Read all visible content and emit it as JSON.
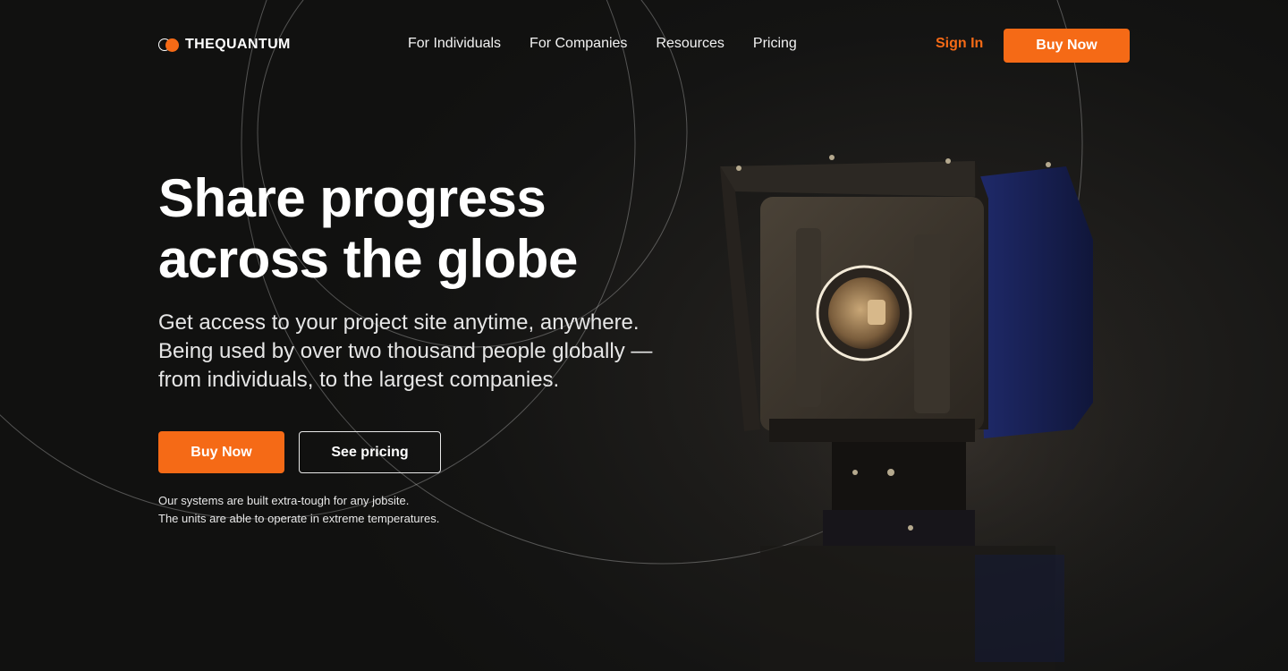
{
  "brand": {
    "name": "THEQUANTUM",
    "accent_color": "#f56a16"
  },
  "nav": {
    "links": [
      {
        "label": "For Individuals"
      },
      {
        "label": "For Companies"
      },
      {
        "label": "Resources"
      },
      {
        "label": "Pricing"
      }
    ],
    "sign_in_label": "Sign In",
    "buy_now_label": "Buy Now"
  },
  "hero": {
    "title_line1": "Share progress",
    "title_line2": "across the globe",
    "subtitle_line1": "Get access to your project site anytime, anywhere.",
    "subtitle_line2": "Being used by over two thousand people globally —",
    "subtitle_line3": "from individuals, to the largest companies.",
    "primary_cta": "Buy Now",
    "secondary_cta": "See pricing",
    "note_line1": "Our systems are built extra-tough for any jobsite.",
    "note_line2": "The units are able to operate in extreme temperatures."
  },
  "image": {
    "icon": "camera-unit-image"
  }
}
